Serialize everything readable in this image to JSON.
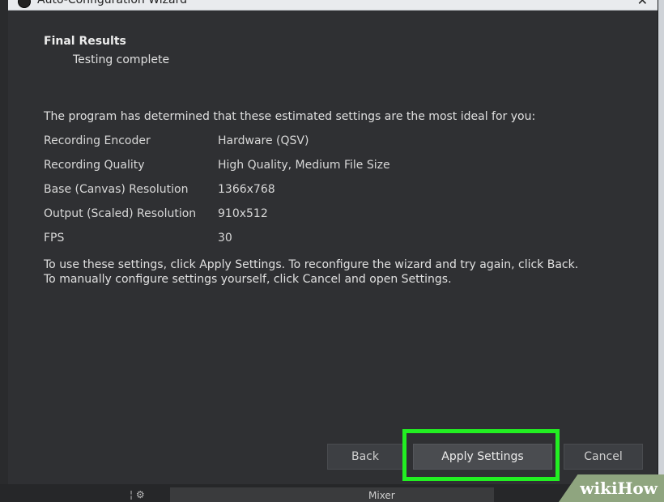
{
  "window": {
    "title": "Auto-Configuration Wizard",
    "close_glyph": "✕"
  },
  "header": {
    "title": "Final Results",
    "subtitle": "Testing complete"
  },
  "intro": "The program has determined that these estimated settings are the most ideal for you:",
  "settings": [
    {
      "label": "Recording Encoder",
      "value": "Hardware (QSV)"
    },
    {
      "label": "Recording Quality",
      "value": "High Quality, Medium File Size"
    },
    {
      "label": "Base (Canvas) Resolution",
      "value": "1366x768"
    },
    {
      "label": "Output (Scaled) Resolution",
      "value": "910x512"
    },
    {
      "label": "FPS",
      "value": "30"
    }
  ],
  "instructions": [
    "To use these settings, click Apply Settings.  To reconfigure the wizard and try again, click Back.",
    "To manually configure settings yourself, click Cancel and open Settings."
  ],
  "buttons": {
    "back": "Back",
    "apply": "Apply Settings",
    "cancel": "Cancel"
  },
  "dock": {
    "label": "Mixer",
    "separator": "¦ ⚙"
  },
  "watermark": {
    "text": "wikiHow"
  },
  "colors": {
    "highlight": "#22ef22",
    "dialog_bg": "#2f3033"
  }
}
